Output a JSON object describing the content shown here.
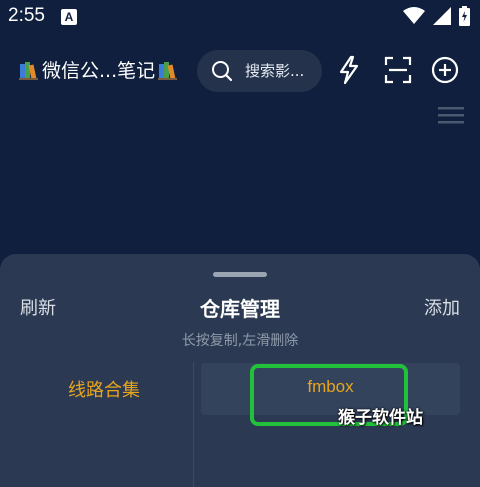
{
  "status_bar": {
    "time": "2:55",
    "notification_letter": "A",
    "icons": [
      "wifi-icon",
      "signal-icon",
      "battery-icon"
    ]
  },
  "header": {
    "title": "微信公...笔记",
    "title_icons": [
      "books-icon",
      "books-icon"
    ],
    "search_placeholder": "搜索影...",
    "actions": [
      "flash-icon",
      "scan-icon",
      "add-circle-icon"
    ],
    "menu_icon": "menu-icon"
  },
  "sheet": {
    "refresh_label": "刷新",
    "title": "仓库管理",
    "add_label": "添加",
    "hint": "长按复制,左滑删除",
    "categories": [
      {
        "label": "线路合集"
      }
    ],
    "repos": [
      {
        "label": "fmbox"
      }
    ]
  },
  "watermark": "猴子软件站",
  "colors": {
    "background": "#0f1f3d",
    "sheet": "#2b3a52",
    "accent": "#e7a51d",
    "highlight": "#21c23a"
  }
}
